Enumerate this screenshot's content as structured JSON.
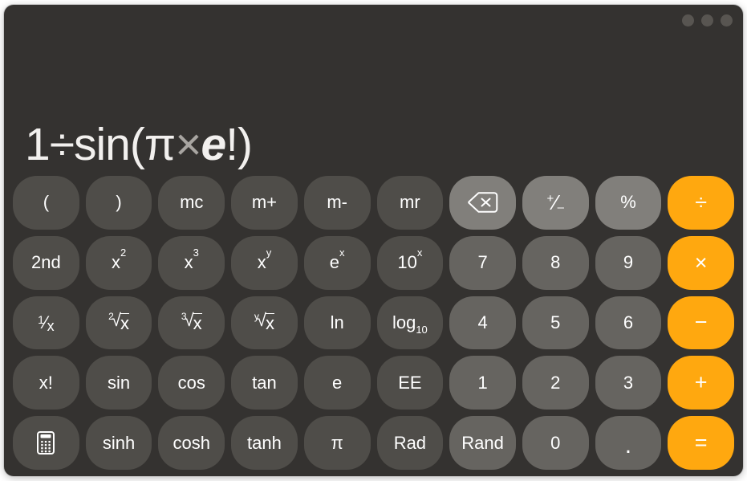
{
  "window": {
    "traffic_lights": [
      {
        "name": "close",
        "color": "#585551"
      },
      {
        "name": "minimize",
        "color": "#585551"
      },
      {
        "name": "maximize",
        "color": "#585551"
      }
    ]
  },
  "display": {
    "expression": "1÷sin(π×e!)",
    "parts": [
      {
        "text": "1",
        "style": "normal"
      },
      {
        "text": "÷",
        "style": "normal"
      },
      {
        "text": "sin(",
        "style": "normal"
      },
      {
        "text": "π",
        "style": "normal"
      },
      {
        "text": "×",
        "style": "dim"
      },
      {
        "text": "e",
        "style": "italic"
      },
      {
        "text": "!",
        "style": "normal"
      },
      {
        "text": ")",
        "style": "normal"
      }
    ]
  },
  "colors": {
    "window_bg": "#343230",
    "function_key": "#4f4d49",
    "utility_key": "#817f7b",
    "number_key": "#666460",
    "operator_key": "#ffa80f",
    "key_text": "#ffffff",
    "display_text": "#f2f0ee"
  },
  "keypad": {
    "rows": [
      {
        "keys": [
          {
            "label": "(",
            "name": "open-paren-button",
            "kind": "fn",
            "glyph": "text"
          },
          {
            "label": ")",
            "name": "close-paren-button",
            "kind": "fn",
            "glyph": "text"
          },
          {
            "label": "mc",
            "name": "memory-clear-button",
            "kind": "fn",
            "glyph": "text"
          },
          {
            "label": "m+",
            "name": "memory-add-button",
            "kind": "fn",
            "glyph": "text"
          },
          {
            "label": "m-",
            "name": "memory-subtract-button",
            "kind": "fn",
            "glyph": "text"
          },
          {
            "label": "mr",
            "name": "memory-recall-button",
            "kind": "fn",
            "glyph": "text"
          },
          {
            "label": "",
            "name": "delete-button",
            "kind": "util",
            "glyph": "delete-icon"
          },
          {
            "label": "+/-",
            "name": "sign-toggle-button",
            "kind": "util",
            "glyph": "plus-minus"
          },
          {
            "label": "%",
            "name": "percent-button",
            "kind": "util",
            "glyph": "text"
          },
          {
            "label": "÷",
            "name": "divide-button",
            "kind": "op",
            "glyph": "op"
          }
        ]
      },
      {
        "keys": [
          {
            "label": "2nd",
            "name": "second-function-button",
            "kind": "fn",
            "glyph": "text"
          },
          {
            "label": "x",
            "sup": "2",
            "name": "x-squared-button",
            "kind": "fn",
            "glyph": "sup"
          },
          {
            "label": "x",
            "sup": "3",
            "name": "x-cubed-button",
            "kind": "fn",
            "glyph": "sup"
          },
          {
            "label": "x",
            "sup": "y",
            "name": "x-to-power-y-button",
            "kind": "fn",
            "glyph": "sup"
          },
          {
            "label": "e",
            "sup": "x",
            "name": "e-to-power-x-button",
            "kind": "fn",
            "glyph": "sup"
          },
          {
            "label": "10",
            "sup": "x",
            "name": "ten-to-power-x-button",
            "kind": "fn",
            "glyph": "sup"
          },
          {
            "label": "7",
            "name": "digit-7-button",
            "kind": "num",
            "glyph": "text"
          },
          {
            "label": "8",
            "name": "digit-8-button",
            "kind": "num",
            "glyph": "text"
          },
          {
            "label": "9",
            "name": "digit-9-button",
            "kind": "num",
            "glyph": "text"
          },
          {
            "label": "×",
            "name": "multiply-button",
            "kind": "op",
            "glyph": "op"
          }
        ]
      },
      {
        "keys": [
          {
            "label": "1/x",
            "name": "reciprocal-button",
            "kind": "fn",
            "glyph": "fraction"
          },
          {
            "index": "2",
            "radicand": "x",
            "name": "square-root-button",
            "kind": "fn",
            "glyph": "radical"
          },
          {
            "index": "3",
            "radicand": "x",
            "name": "cube-root-button",
            "kind": "fn",
            "glyph": "radical"
          },
          {
            "index": "y",
            "radicand": "x",
            "name": "y-root-button",
            "kind": "fn",
            "glyph": "radical"
          },
          {
            "label": "ln",
            "name": "natural-log-button",
            "kind": "fn",
            "glyph": "text"
          },
          {
            "label": "log",
            "sub": "10",
            "name": "log-base-10-button",
            "kind": "fn",
            "glyph": "sub"
          },
          {
            "label": "4",
            "name": "digit-4-button",
            "kind": "num",
            "glyph": "text"
          },
          {
            "label": "5",
            "name": "digit-5-button",
            "kind": "num",
            "glyph": "text"
          },
          {
            "label": "6",
            "name": "digit-6-button",
            "kind": "num",
            "glyph": "text"
          },
          {
            "label": "−",
            "name": "subtract-button",
            "kind": "op",
            "glyph": "op"
          }
        ]
      },
      {
        "keys": [
          {
            "label": "x!",
            "name": "factorial-button",
            "kind": "fn",
            "glyph": "text"
          },
          {
            "label": "sin",
            "name": "sine-button",
            "kind": "fn",
            "glyph": "text"
          },
          {
            "label": "cos",
            "name": "cosine-button",
            "kind": "fn",
            "glyph": "text"
          },
          {
            "label": "tan",
            "name": "tangent-button",
            "kind": "fn",
            "glyph": "text"
          },
          {
            "label": "e",
            "name": "euler-constant-button",
            "kind": "fn",
            "glyph": "text"
          },
          {
            "label": "EE",
            "name": "exponent-entry-button",
            "kind": "fn",
            "glyph": "text"
          },
          {
            "label": "1",
            "name": "digit-1-button",
            "kind": "num",
            "glyph": "text"
          },
          {
            "label": "2",
            "name": "digit-2-button",
            "kind": "num",
            "glyph": "text"
          },
          {
            "label": "3",
            "name": "digit-3-button",
            "kind": "num",
            "glyph": "text"
          },
          {
            "label": "+",
            "name": "add-button",
            "kind": "op",
            "glyph": "op"
          }
        ]
      },
      {
        "keys": [
          {
            "label": "",
            "name": "calculator-mode-button",
            "kind": "fn",
            "glyph": "calculator-icon"
          },
          {
            "label": "sinh",
            "name": "hyperbolic-sine-button",
            "kind": "fn",
            "glyph": "text"
          },
          {
            "label": "cosh",
            "name": "hyperbolic-cosine-button",
            "kind": "fn",
            "glyph": "text"
          },
          {
            "label": "tanh",
            "name": "hyperbolic-tangent-button",
            "kind": "fn",
            "glyph": "text"
          },
          {
            "label": "π",
            "name": "pi-button",
            "kind": "fn",
            "glyph": "text"
          },
          {
            "label": "Rad",
            "name": "radians-button",
            "kind": "fn",
            "glyph": "text"
          },
          {
            "label": "Rand",
            "name": "random-button",
            "kind": "num",
            "glyph": "text"
          },
          {
            "label": "0",
            "name": "digit-0-button",
            "kind": "num",
            "glyph": "text"
          },
          {
            "label": ".",
            "name": "decimal-point-button",
            "kind": "num",
            "glyph": "dot"
          },
          {
            "label": "=",
            "name": "equals-button",
            "kind": "op",
            "glyph": "op"
          }
        ]
      }
    ]
  }
}
